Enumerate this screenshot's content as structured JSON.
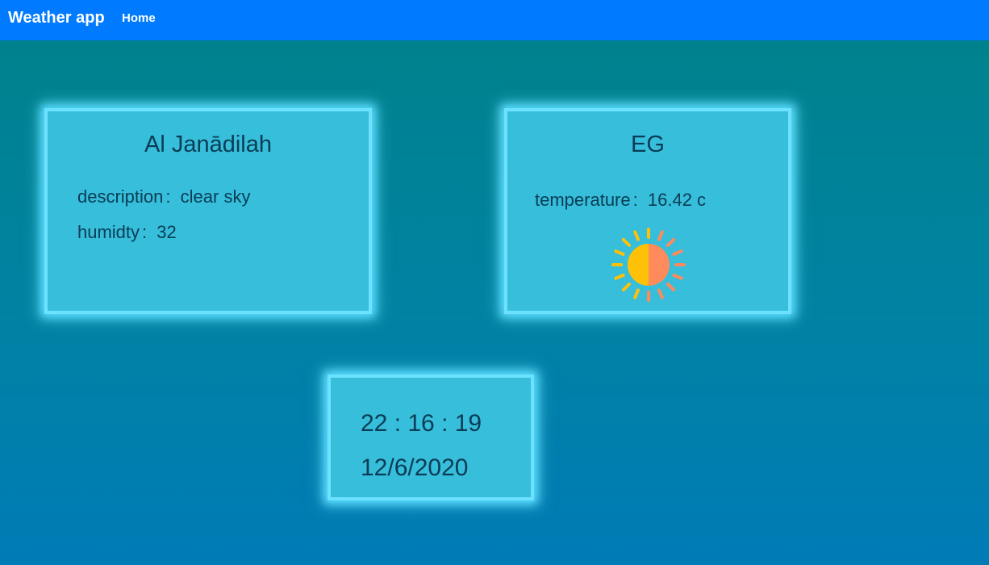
{
  "navbar": {
    "brand": "Weather app",
    "home_label": "Home"
  },
  "location_card": {
    "city": "Al Janādilah",
    "description_label": "description",
    "description_value": "clear sky",
    "humidity_label": "humidty",
    "humidity_value": "32",
    "separator": ":"
  },
  "country_card": {
    "country": "EG",
    "temperature_label": "temperature",
    "temperature_value": "16.42 c",
    "separator": ":",
    "weather_icon": "sun-icon"
  },
  "clock_card": {
    "time": "22 : 16 : 19",
    "date": "12/6/2020"
  },
  "colors": {
    "navbar": "#007bff",
    "card_bg": "#36bedb",
    "card_border": "#6ce2ff",
    "text": "#0b3c55",
    "sun_left": "#ffc107",
    "sun_right": "#ff8a5b"
  }
}
